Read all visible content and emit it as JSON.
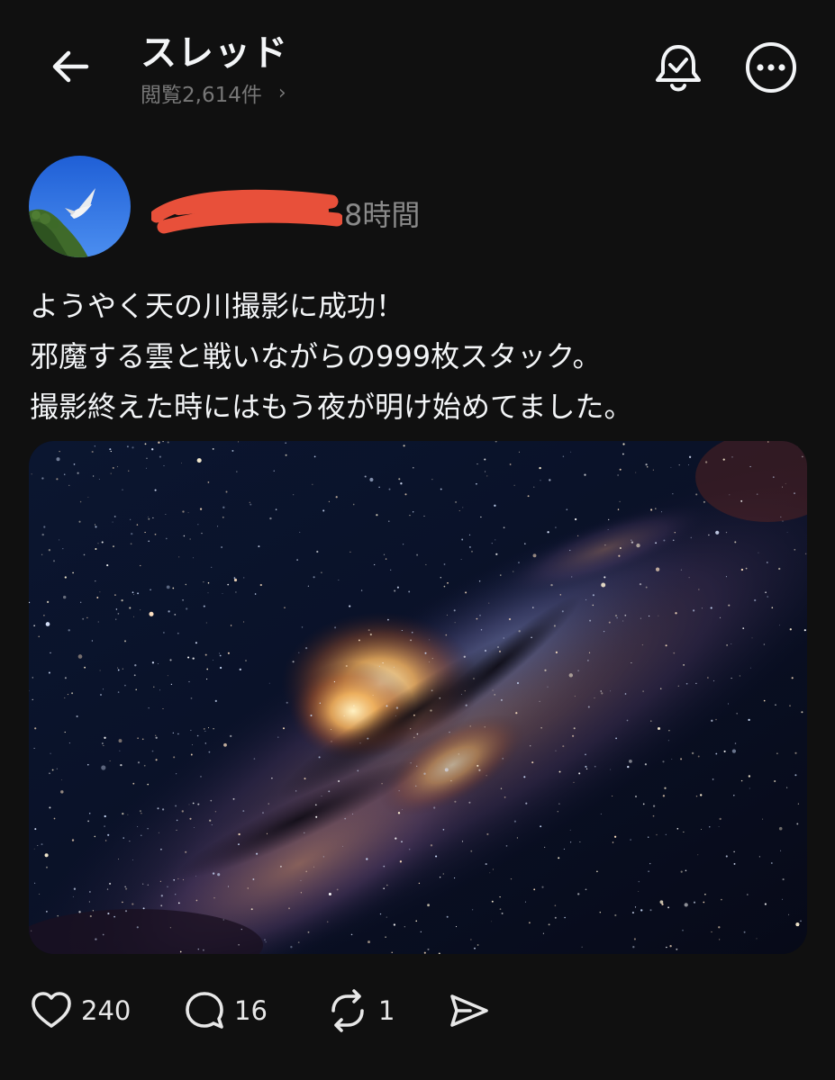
{
  "header": {
    "title": "スレッド",
    "views_label": "閲覧2,614件",
    "chevron": "›",
    "back_icon": "arrow-left-icon",
    "notify_icon": "bell-check-icon",
    "more_icon": "more-horizontal-icon"
  },
  "post": {
    "author_name_redacted": true,
    "time": "8時間",
    "text_lines": [
      "ようやく天の川撮影に成功！",
      "邪魔する雲と戦いながらの999枚スタック。",
      "撮影終えた時にはもう夜が明け始めてました。"
    ]
  },
  "actions": {
    "likes": "240",
    "replies": "16",
    "reposts": "1"
  },
  "colors": {
    "background": "#101010",
    "text": "#f3f5f7",
    "muted": "#8a8a8a",
    "redaction": "#e8503a"
  }
}
